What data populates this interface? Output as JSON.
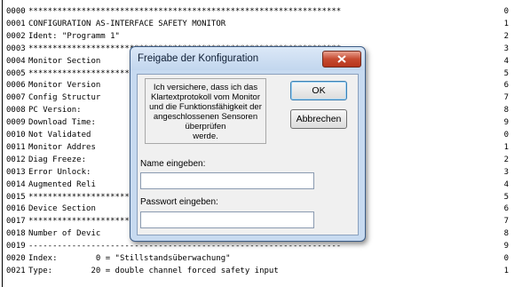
{
  "listing": [
    {
      "ln": "0000",
      "text": "*****************************************************************",
      "cs": "0"
    },
    {
      "ln": "0001",
      "text": "CONFIGURATION AS-INTERFACE SAFETY MONITOR",
      "cs": "1"
    },
    {
      "ln": "0002",
      "text": "Ident: \"Programm 1\"",
      "cs": "2"
    },
    {
      "ln": "0003",
      "text": "*****************************************************************",
      "cs": "3"
    },
    {
      "ln": "0004",
      "text": "Monitor Section",
      "cs": "4"
    },
    {
      "ln": "0005",
      "text": "*****************************************************************",
      "cs": "5"
    },
    {
      "ln": "0006",
      "text": "Monitor Version",
      "cs": "6"
    },
    {
      "ln": "0007",
      "text": "Config Structur",
      "cs": "7"
    },
    {
      "ln": "0008",
      "text": "PC Version:",
      "cs": "8"
    },
    {
      "ln": "0009",
      "text": "Download Time:",
      "cs": "9"
    },
    {
      "ln": "0010",
      "text": "Not Validated",
      "cs": "0"
    },
    {
      "ln": "0011",
      "text": "Monitor Addres",
      "cs": "1"
    },
    {
      "ln": "0012",
      "text": "Diag Freeze:",
      "cs": "2"
    },
    {
      "ln": "0013",
      "text": "Error Unlock:",
      "cs": "3"
    },
    {
      "ln": "0014",
      "text": "Augmented Reli",
      "cs": "4"
    },
    {
      "ln": "0015",
      "text": "*****************************************************************",
      "cs": "5"
    },
    {
      "ln": "0016",
      "text": "Device Section",
      "cs": "6"
    },
    {
      "ln": "0017",
      "text": "*****************************************************************",
      "cs": "7"
    },
    {
      "ln": "0018",
      "text": "Number of Devic",
      "cs": "8"
    },
    {
      "ln": "0019",
      "text": "-----------------------------------------------------------------",
      "cs": "9"
    },
    {
      "ln": "0020",
      "text": "Index:        0 = \"Stillstandsüberwachung\"",
      "cs": "0"
    },
    {
      "ln": "0021",
      "text": "Type:        20 = double channel forced safety input",
      "cs": "1"
    }
  ],
  "dialog": {
    "title": "Freigabe der Konfiguration",
    "message": [
      "Ich versichere, dass ich das",
      "Klartextprotokoll vom Monitor",
      "und die Funktionsfähigkeit der",
      "angeschlossenen Sensoren überprüfen",
      "werde."
    ],
    "ok_label": "OK",
    "cancel_label": "Abbrechen",
    "name_label": "Name eingeben:",
    "name_value": "",
    "password_label": "Passwort eingeben:",
    "password_value": ""
  },
  "colors": {
    "close_button": "#c64a30",
    "dialog_frame": "#c7daf0"
  }
}
